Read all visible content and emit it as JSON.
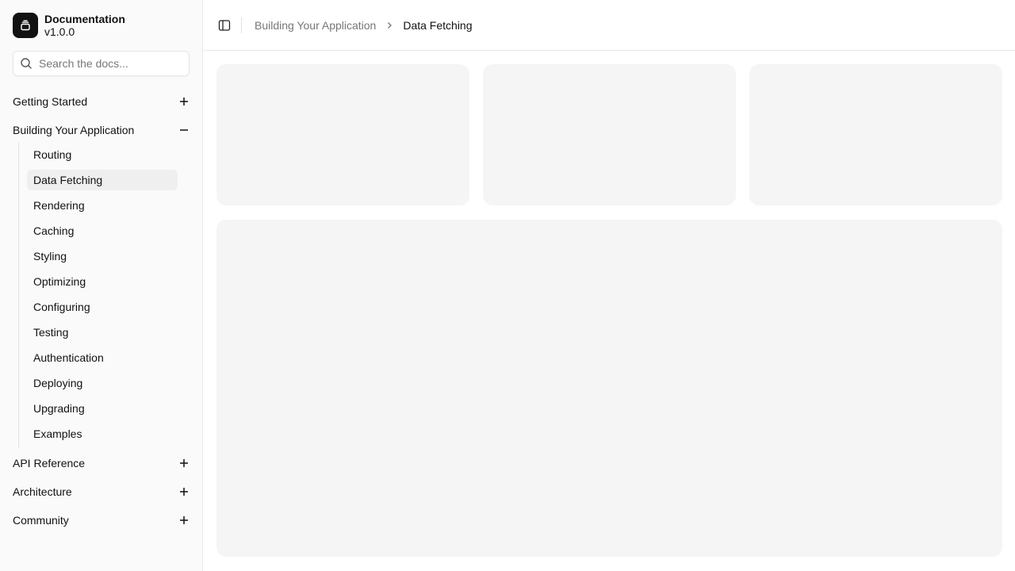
{
  "brand": {
    "title": "Documentation",
    "version": "v1.0.0",
    "logo_icon": "layers-icon"
  },
  "search": {
    "placeholder": "Search the docs..."
  },
  "nav": {
    "groups": [
      {
        "label": "Getting Started",
        "expanded": false
      },
      {
        "label": "Building Your Application",
        "expanded": true
      },
      {
        "label": "API Reference",
        "expanded": false
      },
      {
        "label": "Architecture",
        "expanded": false
      },
      {
        "label": "Community",
        "expanded": false
      }
    ],
    "sub_items": [
      {
        "label": "Routing"
      },
      {
        "label": "Data Fetching",
        "active": true
      },
      {
        "label": "Rendering"
      },
      {
        "label": "Caching"
      },
      {
        "label": "Styling"
      },
      {
        "label": "Optimizing"
      },
      {
        "label": "Configuring"
      },
      {
        "label": "Testing"
      },
      {
        "label": "Authentication"
      },
      {
        "label": "Deploying"
      },
      {
        "label": "Upgrading"
      },
      {
        "label": "Examples"
      }
    ]
  },
  "breadcrumb": {
    "parent": "Building Your Application",
    "current": "Data Fetching"
  },
  "colors": {
    "sidebar_bg": "#fafafa",
    "skeleton": "#f5f5f5",
    "active_item_bg": "#efefef",
    "logo_bg": "#121212"
  }
}
